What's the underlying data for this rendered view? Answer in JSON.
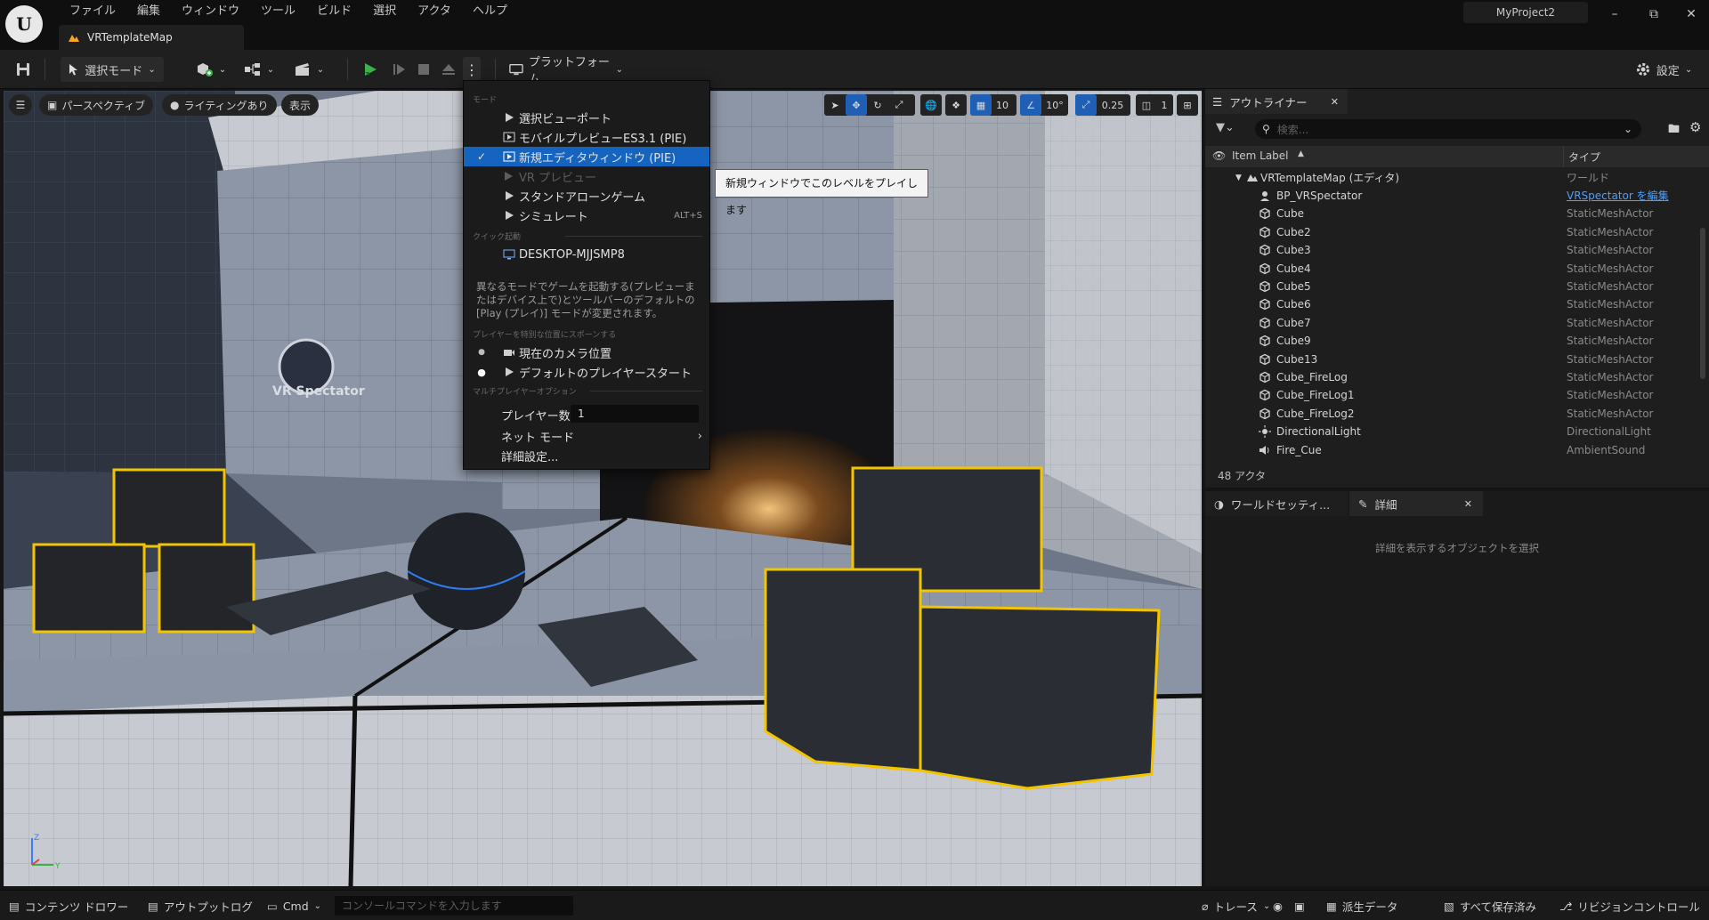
{
  "titlebar": {
    "menu": [
      "ファイル",
      "編集",
      "ウィンドウ",
      "ツール",
      "ビルド",
      "選択",
      "アクタ",
      "ヘルプ"
    ],
    "project_name": "MyProject2",
    "map_tab": "VRTemplateMap"
  },
  "toolbar": {
    "select_mode": "選択モード",
    "platform": "プラットフォーム",
    "settings": "設定"
  },
  "viewport": {
    "perspective": "パースペクティブ",
    "lighting": "ライティングあり",
    "show": "表示",
    "grid_snap": "10",
    "rot_snap": "10°",
    "scale_snap": "0.25",
    "camera_speed": "1",
    "spectator_label": "VR Spectator"
  },
  "play_menu": {
    "header_mode": "モード",
    "items": [
      {
        "label": "選択ビューポート",
        "checked": false,
        "disabled": false
      },
      {
        "label": "モバイルプレビューES3.1 (PIE)",
        "checked": false,
        "disabled": false
      },
      {
        "label": "新規エディタウィンドウ (PIE)",
        "checked": true,
        "disabled": false
      },
      {
        "label": "VR プレビュー",
        "checked": false,
        "disabled": true
      },
      {
        "label": "スタンドアローンゲーム",
        "checked": false,
        "disabled": false
      },
      {
        "label": "シミュレート",
        "checked": false,
        "disabled": false,
        "shortcut": "ALT+S"
      }
    ],
    "header_quick": "クイック起動",
    "device": "DESKTOP-MJJSMP8",
    "description": "異なるモードでゲームを起動する(プレビューまたはデバイス上で)とツールバーのデフォルトの[Play (プレイ)] モードが変更されます。",
    "header_spawn": "プレイヤーを特別な位置にスポーンする",
    "spawn_options": [
      "現在のカメラ位置",
      "デフォルトのプレイヤースタート"
    ],
    "header_multi": "マルチプレイヤーオプション",
    "player_count_label": "プレイヤー数",
    "player_count_value": "1",
    "net_mode": "ネット モード",
    "advanced": "詳細設定..."
  },
  "tooltip": "新規ウィンドウでこのレベルをプレイします",
  "outliner": {
    "tab": "アウトライナー",
    "search_placeholder": "検索...",
    "col_label": "Item Label",
    "col_type": "タイプ",
    "root": {
      "name": "VRTemplateMap (エディタ)",
      "type": "ワールド"
    },
    "rows": [
      {
        "name": "BP_VRSpectator",
        "type": "VRSpectator を編集",
        "icon": "person-icon",
        "link": true
      },
      {
        "name": "Cube",
        "type": "StaticMeshActor",
        "icon": "cube-icon"
      },
      {
        "name": "Cube2",
        "type": "StaticMeshActor",
        "icon": "cube-icon"
      },
      {
        "name": "Cube3",
        "type": "StaticMeshActor",
        "icon": "cube-icon"
      },
      {
        "name": "Cube4",
        "type": "StaticMeshActor",
        "icon": "cube-icon"
      },
      {
        "name": "Cube5",
        "type": "StaticMeshActor",
        "icon": "cube-icon"
      },
      {
        "name": "Cube6",
        "type": "StaticMeshActor",
        "icon": "cube-icon"
      },
      {
        "name": "Cube7",
        "type": "StaticMeshActor",
        "icon": "cube-icon"
      },
      {
        "name": "Cube9",
        "type": "StaticMeshActor",
        "icon": "cube-icon"
      },
      {
        "name": "Cube13",
        "type": "StaticMeshActor",
        "icon": "cube-icon"
      },
      {
        "name": "Cube_FireLog",
        "type": "StaticMeshActor",
        "icon": "cube-icon"
      },
      {
        "name": "Cube_FireLog1",
        "type": "StaticMeshActor",
        "icon": "cube-icon"
      },
      {
        "name": "Cube_FireLog2",
        "type": "StaticMeshActor",
        "icon": "cube-icon"
      },
      {
        "name": "DirectionalLight",
        "type": "DirectionalLight",
        "icon": "sun-icon"
      },
      {
        "name": "Fire_Cue",
        "type": "AmbientSound",
        "icon": "speaker-icon"
      }
    ],
    "actor_count": "48 アクタ"
  },
  "details": {
    "world_tab": "ワールドセッティ...",
    "details_tab": "詳細",
    "empty_message": "詳細を表示するオブジェクトを選択"
  },
  "statusbar": {
    "content_drawer": "コンテンツ ドロワー",
    "output_log": "アウトプットログ",
    "cmd": "Cmd",
    "console_placeholder": "コンソールコマンドを入力します",
    "trace": "トレース",
    "derived_data": "派生データ",
    "save_all": "すべて保存済み",
    "revision_control": "リビジョンコントロール"
  },
  "colors": {
    "accent": "#1565c0",
    "play_green": "#3cb14a",
    "highlight_yellow": "#f2c500"
  }
}
